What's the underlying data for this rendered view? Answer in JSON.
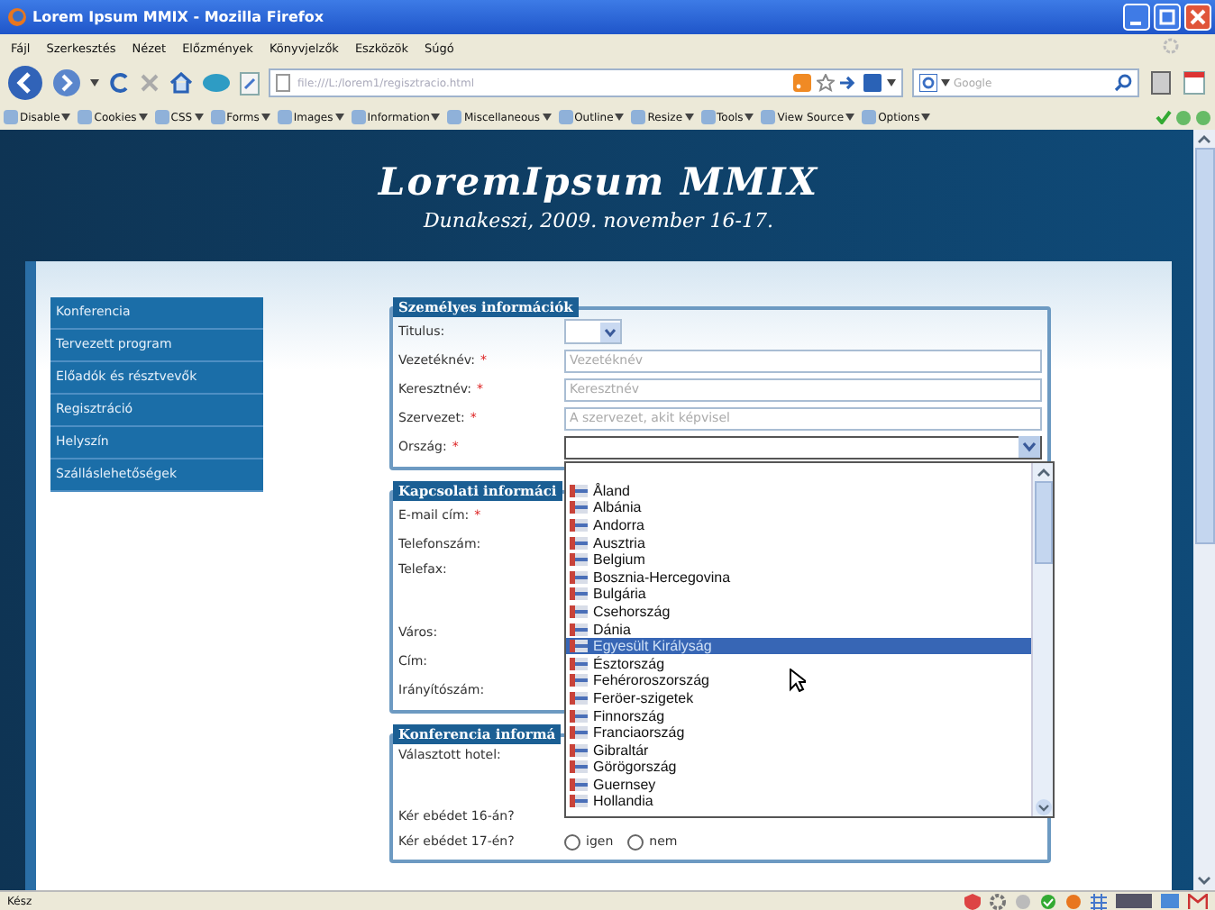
{
  "window": {
    "title": "Lorem Ipsum MMIX - Mozilla Firefox"
  },
  "menu": [
    "Fájl",
    "Szerkesztés",
    "Nézet",
    "Előzmények",
    "Könyvjelzők",
    "Eszközök",
    "Súgó"
  ],
  "address_bar": {
    "value": "file:///L:/lorem1/regisztracio.html"
  },
  "search": {
    "placeholder": "Google"
  },
  "dev_toolbar": [
    "Disable",
    "Cookies",
    "CSS",
    "Forms",
    "Images",
    "Information",
    "Miscellaneous",
    "Outline",
    "Resize",
    "Tools",
    "View Source",
    "Options"
  ],
  "page": {
    "title": "LoremIpsum MMIX",
    "subtitle": "Dunakeszi, 2009. november 16-17."
  },
  "sidebar": {
    "items": [
      {
        "label": "Konferencia"
      },
      {
        "label": "Tervezett program"
      },
      {
        "label": "Előadók és résztvevők"
      },
      {
        "label": "Regisztráció"
      },
      {
        "label": "Helyszín"
      },
      {
        "label": "Szálláslehetőségek"
      }
    ]
  },
  "sections": [
    {
      "legend": "Személyes információk",
      "rows": [
        {
          "label": "Titulus:",
          "kind": "small-select"
        },
        {
          "label": "Vezetéknév:",
          "mark": "*",
          "kind": "text",
          "placeholder": "Vezetéknév"
        },
        {
          "label": "Keresztnév:",
          "mark": "*",
          "kind": "text",
          "placeholder": "Keresztnév"
        },
        {
          "label": "Szervezet:",
          "mark": "*",
          "kind": "text",
          "placeholder": "A szervezet, akit képvisel"
        },
        {
          "label": "Ország:",
          "mark": "*",
          "kind": "select",
          "dropdown": {
            "items": [
              {
                "label": "Åland",
                "selected": false
              },
              {
                "label": "Albánia",
                "selected": false
              },
              {
                "label": "Andorra",
                "selected": false
              },
              {
                "label": "Ausztria",
                "selected": false
              },
              {
                "label": "Belgium",
                "selected": false
              },
              {
                "label": "Bosznia-Hercegovina",
                "selected": false
              },
              {
                "label": "Bulgária",
                "selected": false
              },
              {
                "label": "Csehország",
                "selected": false
              },
              {
                "label": "Dánia",
                "selected": false
              },
              {
                "label": "Egyesült Királyság",
                "selected": true
              },
              {
                "label": "Észtország",
                "selected": false
              },
              {
                "label": "Fehéroroszország",
                "selected": false
              },
              {
                "label": "Feröer-szigetek",
                "selected": false
              },
              {
                "label": "Finnország",
                "selected": false
              },
              {
                "label": "Franciaország",
                "selected": false
              },
              {
                "label": "Gibraltár",
                "selected": false
              },
              {
                "label": "Görögország",
                "selected": false
              },
              {
                "label": "Guernsey",
                "selected": false
              },
              {
                "label": "Hollandia",
                "selected": false
              }
            ]
          }
        }
      ]
    },
    {
      "legend": "Kapcsolati informáci",
      "rows": [
        {
          "label": "E-mail cím:",
          "mark": "*",
          "kind": "covered"
        },
        {
          "label": "Telefonszám:",
          "kind": "covered"
        },
        {
          "label": "Telefax:",
          "kind": "covered-tall"
        },
        {
          "label": "Város:",
          "kind": "covered"
        },
        {
          "label": "Cím:",
          "kind": "covered"
        },
        {
          "label": "Irányítószám:",
          "kind": "covered"
        }
      ]
    },
    {
      "legend": "Konferencia informá",
      "rows": [
        {
          "label": "Választott hotel:",
          "kind": "covered-tall"
        },
        {
          "label": "Kér ebédet 16-án?",
          "kind": "covered-short"
        },
        {
          "label": "Kér ebédet 17-én?",
          "kind": "radios",
          "options": [
            {
              "label": "igen",
              "selected": false
            },
            {
              "label": "nem",
              "selected": false
            }
          ]
        }
      ]
    }
  ],
  "status_bar": {
    "text": "Kész"
  }
}
